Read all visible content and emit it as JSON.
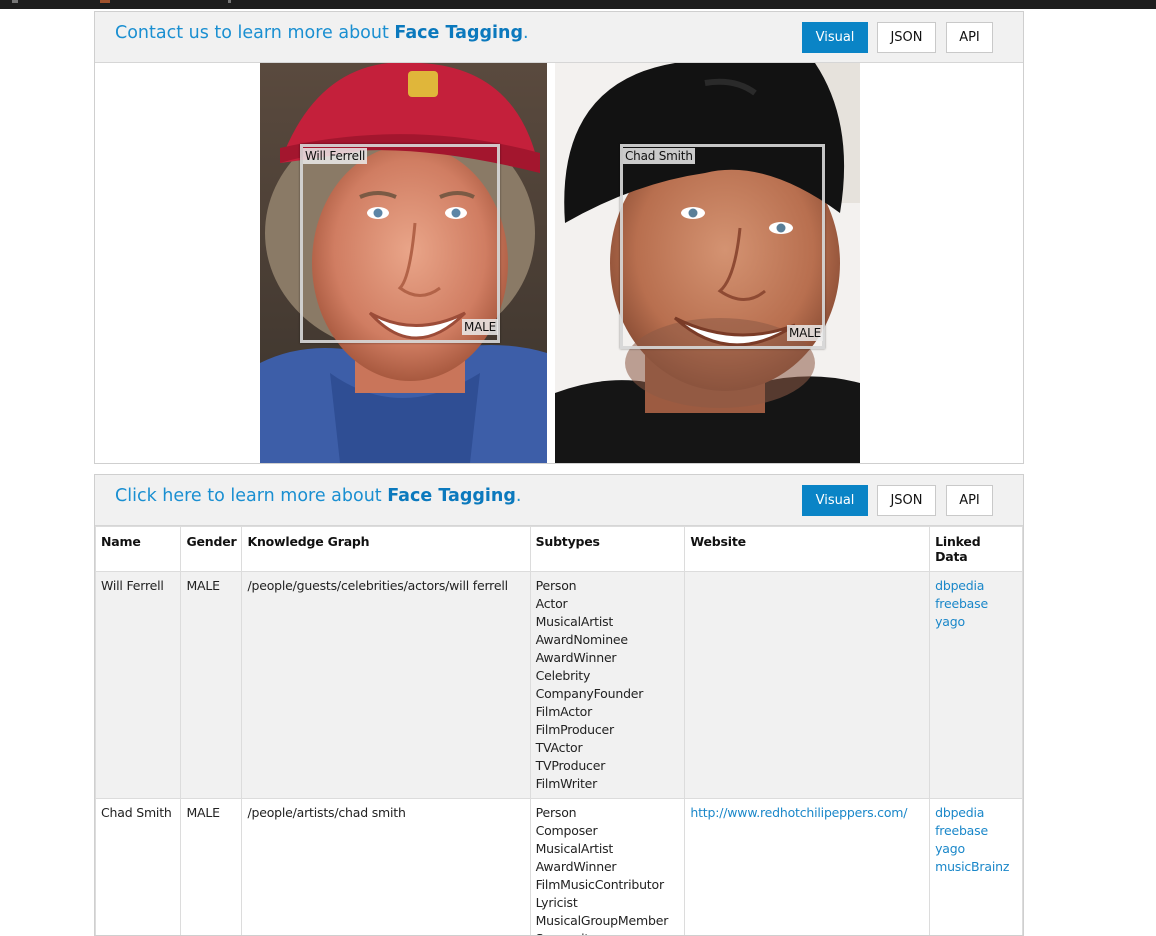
{
  "visual_panel": {
    "heading_prefix": "Contact us to learn more about",
    "heading_product": "Face Tagging",
    "heading_suffix": ".",
    "buttons": {
      "visual": "Visual",
      "json": "JSON",
      "api": "API"
    },
    "faces": [
      {
        "name": "Will Ferrell",
        "gender": "MALE",
        "photo_desc": "man in red cap, blue jacket"
      },
      {
        "name": "Chad Smith",
        "gender": "MALE",
        "photo_desc": "man in black beanie"
      }
    ]
  },
  "table_panel": {
    "heading_prefix": "Click here to learn more about",
    "heading_product": "Face Tagging",
    "heading_suffix": ".",
    "buttons": {
      "visual": "Visual",
      "json": "JSON",
      "api": "API"
    },
    "columns": [
      "Name",
      "Gender",
      "Knowledge Graph",
      "Subtypes",
      "Website",
      "Linked Data"
    ],
    "rows": [
      {
        "name": "Will Ferrell",
        "gender": "MALE",
        "knowledge_graph": "/people/guests/celebrities/actors/will ferrell",
        "subtypes": [
          "Person",
          "Actor",
          "MusicalArtist",
          "AwardNominee",
          "AwardWinner",
          "Celebrity",
          "CompanyFounder",
          "FilmActor",
          "FilmProducer",
          "TVActor",
          "TVProducer",
          "FilmWriter"
        ],
        "website": "",
        "linked_data": [
          "dbpedia",
          "freebase",
          "yago"
        ]
      },
      {
        "name": "Chad Smith",
        "gender": "MALE",
        "knowledge_graph": "/people/artists/chad smith",
        "subtypes": [
          "Person",
          "Composer",
          "MusicalArtist",
          "AwardWinner",
          "FilmMusicContributor",
          "Lyricist",
          "MusicalGroupMember",
          "Songwriter"
        ],
        "website": "http://www.redhotchilipeppers.com/",
        "linked_data": [
          "dbpedia",
          "freebase",
          "yago",
          "musicBrainz"
        ]
      }
    ]
  },
  "colors": {
    "accent_blue": "#0a84c6",
    "link_blue": "#1a87c9",
    "header_gray": "#f1f1f1"
  }
}
